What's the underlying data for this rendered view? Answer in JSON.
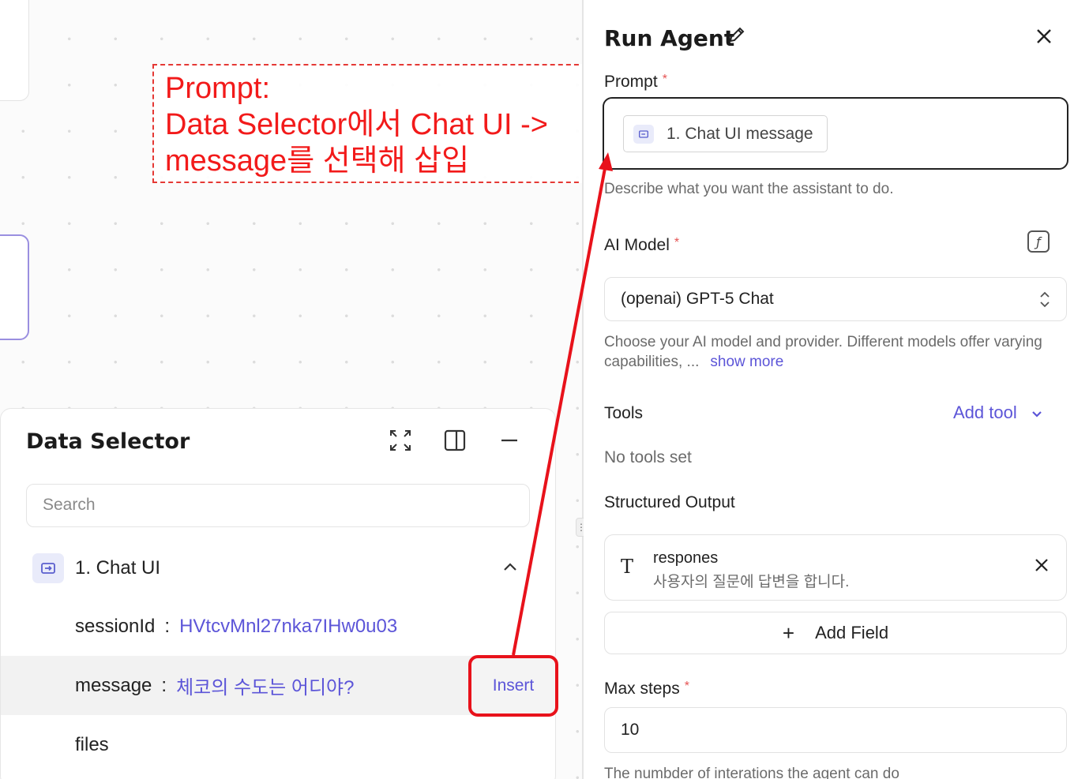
{
  "callout": {
    "line1": "Prompt:",
    "line2": "Data Selector에서 Chat UI ->",
    "line3": "message를 선택해 삽입",
    "color": "#f21a1a"
  },
  "data_selector": {
    "title": "Data Selector",
    "search_placeholder": "Search",
    "icons": [
      "expand-icon",
      "side-panel-icon",
      "minimize-icon"
    ],
    "group": {
      "icon": "chat-ui-icon",
      "label": "1. Chat UI",
      "expanded": true
    },
    "rows": [
      {
        "key": "sessionId",
        "sep": ":",
        "value": "HVtcvMnl27nka7IHw0u03"
      },
      {
        "key": "message",
        "sep": ":",
        "value": "체코의 수도는 어디야?",
        "action": "Insert"
      },
      {
        "key": "files"
      }
    ]
  },
  "run_agent": {
    "title": "Run Agent",
    "prompt": {
      "label": "Prompt",
      "required": "*",
      "chip": "1. Chat UI message",
      "hint": "Describe what you want the assistant to do."
    },
    "ai_model": {
      "label": "AI Model",
      "required": "*",
      "value": "(openai) GPT-5 Chat",
      "hint": "Choose your AI model and provider. Different models offer varying",
      "hint2": "capabilities, ...",
      "show_more": "show more"
    },
    "tools": {
      "label": "Tools",
      "add_tool": "Add tool",
      "empty": "No tools set"
    },
    "structured_output": {
      "label": "Structured Output",
      "field_name": "respones",
      "field_desc": "사용자의 질문에 답변을 합니다.",
      "add_field": "Add Field"
    },
    "max_steps": {
      "label": "Max steps",
      "required": "*",
      "value": "10",
      "hint": "The numbder of interations the agent can do"
    }
  },
  "colors": {
    "accent": "#5c55d8",
    "highlight": "#e8121b"
  }
}
